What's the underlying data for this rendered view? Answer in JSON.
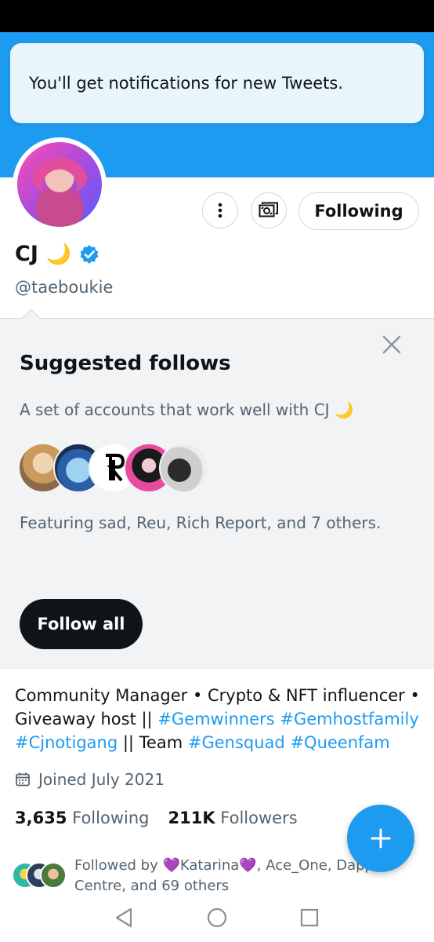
{
  "toast": {
    "message": "You'll get notifications for new Tweets."
  },
  "profile": {
    "name": "CJ",
    "name_emoji": "🌙",
    "handle": "@taeboukie",
    "following_button_label": "Following"
  },
  "suggested": {
    "title": "Suggested follows",
    "subtitle": "A set of accounts that work well with CJ 🌙",
    "featuring": "Featuring sad, Reu, Rich Report, and 7 others.",
    "follow_all_label": "Follow all"
  },
  "bio": {
    "part1": "Community Manager • Crypto & NFT influencer • Giveaway host || ",
    "tag1": "#Gemwinners",
    "tag2": "#Gemhostfamily",
    "tag3": "#Cjnotigang",
    "part2": " || Team ",
    "tag4": "#Gensquad",
    "tag5": "#Queenfam"
  },
  "joined": "Joined July 2021",
  "stats": {
    "following_count": "3,635",
    "following_label": "Following",
    "followers_count": "211K",
    "followers_label": "Followers"
  },
  "followed_by": "Followed by 💜Katarina💜, Ace_One, Dapp Centre, and 69 others",
  "colors": {
    "brand": "#1d9bf0",
    "text": "#0f1419",
    "muted": "#536471"
  },
  "icons": [
    "more-vertical-icon",
    "subscribe-icon",
    "verified-badge-icon",
    "close-icon",
    "calendar-icon",
    "compose-plus-icon",
    "back-nav-icon",
    "home-nav-icon",
    "recents-nav-icon"
  ]
}
